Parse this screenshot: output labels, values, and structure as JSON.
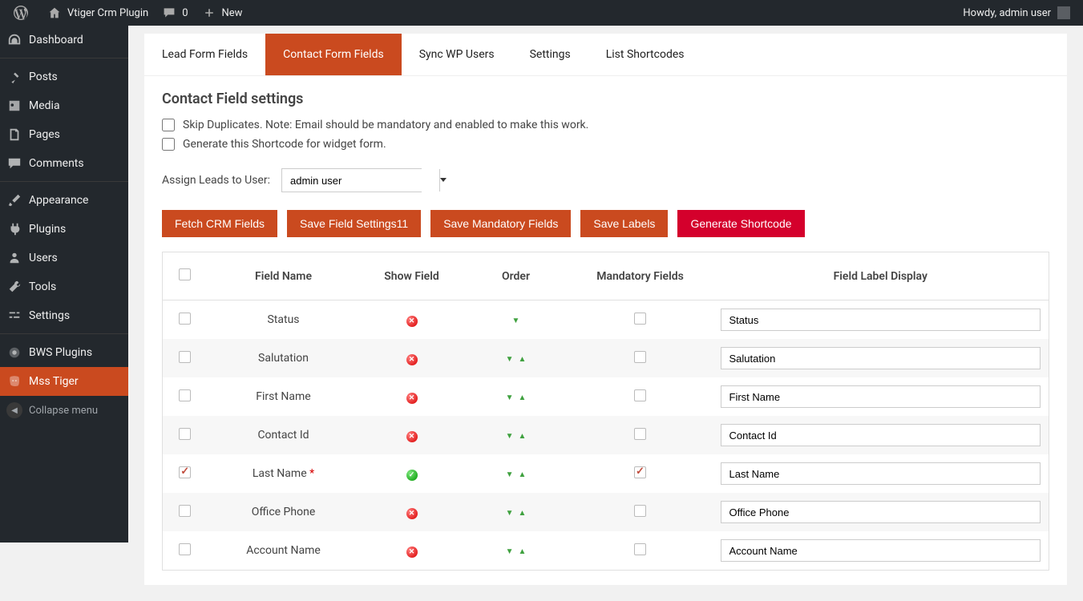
{
  "admin_bar": {
    "site_title": "Vtiger Crm Plugin",
    "comments_count": "0",
    "new_label": "New",
    "howdy": "Howdy, admin user"
  },
  "sidebar": {
    "items": [
      {
        "label": "Dashboard",
        "icon": "dashboard"
      },
      {
        "label": "Posts",
        "icon": "pin"
      },
      {
        "label": "Media",
        "icon": "media"
      },
      {
        "label": "Pages",
        "icon": "pages"
      },
      {
        "label": "Comments",
        "icon": "comment"
      },
      {
        "label": "Appearance",
        "icon": "brush"
      },
      {
        "label": "Plugins",
        "icon": "plug"
      },
      {
        "label": "Users",
        "icon": "user"
      },
      {
        "label": "Tools",
        "icon": "wrench"
      },
      {
        "label": "Settings",
        "icon": "sliders"
      },
      {
        "label": "BWS Plugins",
        "icon": "bws"
      },
      {
        "label": "Mss Tiger",
        "icon": "tiger"
      }
    ],
    "collapse": "Collapse menu"
  },
  "tabs": [
    {
      "label": "Lead Form Fields",
      "active": false
    },
    {
      "label": "Contact Form Fields",
      "active": true
    },
    {
      "label": "Sync WP Users",
      "active": false
    },
    {
      "label": "Settings",
      "active": false
    },
    {
      "label": "List Shortcodes",
      "active": false
    }
  ],
  "page": {
    "heading": "Contact Field settings",
    "skip_duplicates": "Skip Duplicates. Note: Email should be mandatory and enabled to make this work.",
    "generate_shortcode_widget": "Generate this Shortcode for widget form.",
    "assign_label": "Assign Leads to User:",
    "assign_value": "admin user"
  },
  "buttons": {
    "fetch": "Fetch CRM Fields",
    "save_settings": "Save Field Settings11",
    "save_mandatory": "Save Mandatory Fields",
    "save_labels": "Save Labels",
    "generate": "Generate Shortcode"
  },
  "table": {
    "headers": {
      "field_name": "Field Name",
      "show_field": "Show Field",
      "order": "Order",
      "mandatory": "Mandatory Fields",
      "label": "Field Label Display"
    },
    "rows": [
      {
        "checked": false,
        "name": "Status",
        "show": "red",
        "up": false,
        "down": true,
        "mandatory": false,
        "label": "Status",
        "required": false
      },
      {
        "checked": false,
        "name": "Salutation",
        "show": "red",
        "up": true,
        "down": true,
        "mandatory": false,
        "label": "Salutation",
        "required": false
      },
      {
        "checked": false,
        "name": "First Name",
        "show": "red",
        "up": true,
        "down": true,
        "mandatory": false,
        "label": "First Name",
        "required": false
      },
      {
        "checked": false,
        "name": "Contact Id",
        "show": "red",
        "up": true,
        "down": true,
        "mandatory": false,
        "label": "Contact Id",
        "required": false
      },
      {
        "checked": true,
        "name": "Last Name",
        "show": "green",
        "up": true,
        "down": true,
        "mandatory": true,
        "label": "Last Name",
        "required": true
      },
      {
        "checked": false,
        "name": "Office Phone",
        "show": "red",
        "up": true,
        "down": true,
        "mandatory": false,
        "label": "Office Phone",
        "required": false
      },
      {
        "checked": false,
        "name": "Account Name",
        "show": "red",
        "up": true,
        "down": true,
        "mandatory": false,
        "label": "Account Name",
        "required": false
      }
    ]
  }
}
